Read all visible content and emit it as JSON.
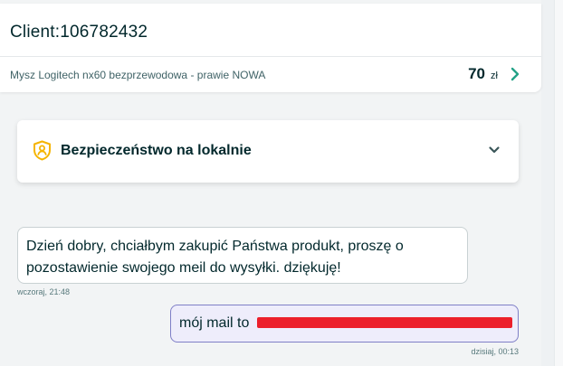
{
  "header": {
    "client_title": "Client:106782432"
  },
  "ad": {
    "title": "Mysz Logitech nx60 bezprzewodowa - prawie NOWA",
    "price": "70",
    "currency": "zł",
    "chevron_icon": "chevron-right-icon",
    "accent_color": "#23a287"
  },
  "safety": {
    "title": "Bezpieczeństwo na lokalnie",
    "icon": "shield-user-icon",
    "icon_color": "#f5b400",
    "chevron_icon": "chevron-down-icon"
  },
  "messages": [
    {
      "direction": "incoming",
      "text": "Dzień dobry, chciałbym zakupić Państwa produkt, proszę o pozostawienie swojego meil do wysyłki. dziękuję!",
      "time": "wczoraj, 21:48"
    },
    {
      "direction": "outgoing",
      "text": "mój mail to",
      "redacted": true,
      "redaction_color": "#ec1f2b",
      "time": "dzisiaj, 00:13"
    }
  ]
}
